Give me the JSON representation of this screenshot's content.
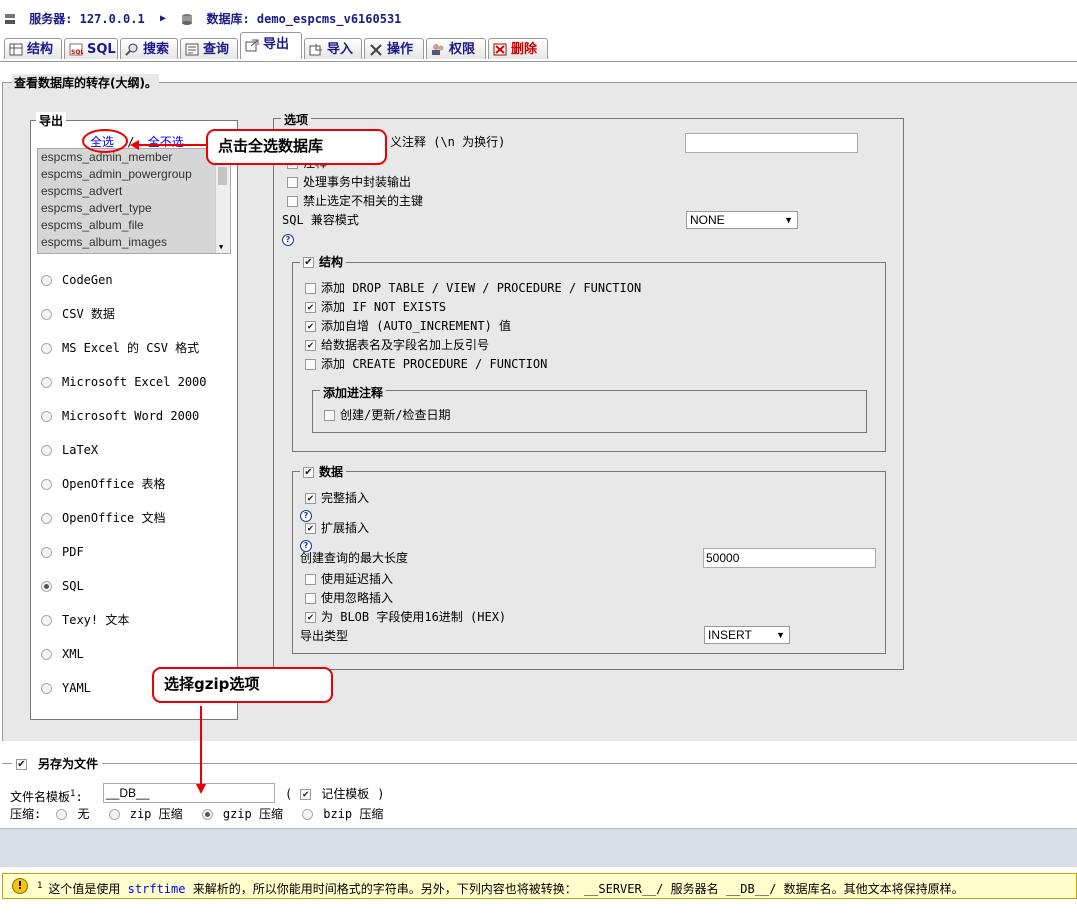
{
  "header": {
    "server_label": "服务器: 127.0.0.1",
    "database_label": "数据库: demo_espcms_v6160531"
  },
  "tabs": [
    {
      "label": "结构",
      "icon": "structure-icon"
    },
    {
      "label": "SQL",
      "icon": "sql-icon"
    },
    {
      "label": "搜索",
      "icon": "search-icon"
    },
    {
      "label": "查询",
      "icon": "query-icon"
    },
    {
      "label": "导出",
      "icon": "export-icon",
      "active": true
    },
    {
      "label": "导入",
      "icon": "import-icon"
    },
    {
      "label": "操作",
      "icon": "operations-icon"
    },
    {
      "label": "权限",
      "icon": "privileges-icon"
    },
    {
      "label": "删除",
      "icon": "drop-icon"
    }
  ],
  "main": {
    "title": "查看数据库的转存(大纲)。"
  },
  "export": {
    "legend": "导出",
    "select_all": "全选",
    "separator": "/",
    "deselect_all": "全不选",
    "databases": [
      "espcms_admin_member",
      "espcms_admin_powergroup",
      "espcms_advert",
      "espcms_advert_type",
      "espcms_album_file",
      "espcms_album_images"
    ],
    "formats": [
      {
        "label": "CodeGen",
        "selected": false
      },
      {
        "label": "CSV 数据",
        "selected": false
      },
      {
        "label": "MS Excel 的 CSV 格式",
        "selected": false
      },
      {
        "label": "Microsoft Excel 2000",
        "selected": false
      },
      {
        "label": "Microsoft Word 2000",
        "selected": false
      },
      {
        "label": "LaTeX",
        "selected": false
      },
      {
        "label": "OpenOffice 表格",
        "selected": false
      },
      {
        "label": "OpenOffice 文档",
        "selected": false
      },
      {
        "label": "PDF",
        "selected": false
      },
      {
        "label": "SQL",
        "selected": true
      },
      {
        "label": "Texy! 文本",
        "selected": false
      },
      {
        "label": "XML",
        "selected": false
      },
      {
        "label": "YAML",
        "selected": false
      }
    ]
  },
  "options": {
    "legend": "选项",
    "custom_comment_label": "义注释 (\\n 为换行)",
    "custom_comment_value": "",
    "partial_label": "注释",
    "transaction_label": "处理事务中封装输出",
    "disable_fk_label": "禁止选定不相关的主键",
    "sql_compat_label": "SQL 兼容模式",
    "sql_compat_value": "NONE",
    "structure": {
      "legend": "结构",
      "drop_table": "添加 DROP TABLE / VIEW / PROCEDURE / FUNCTION",
      "if_not_exists": "添加 IF NOT EXISTS",
      "auto_increment": "添加自增 (AUTO_INCREMENT) 值",
      "backquotes": "给数据表名及字段名加上反引号",
      "create_procedure": "添加 CREATE PROCEDURE / FUNCTION",
      "comments_legend": "添加进注释",
      "dates": "创建/更新/检查日期"
    },
    "data": {
      "legend": "数据",
      "complete_inserts": "完整插入",
      "extended_inserts": "扩展插入",
      "max_query_label": "创建查询的最大长度",
      "max_query_value": "50000",
      "delayed": "使用延迟插入",
      "ignore": "使用忽略插入",
      "hex_blob": "为 BLOB 字段使用16进制 (HEX)",
      "export_type_label": "导出类型",
      "export_type_value": "INSERT"
    }
  },
  "save_as": {
    "legend": "另存为文件",
    "filename_label": "文件名模板",
    "footnote_mark": "1",
    "colon": ":",
    "filename_value": "__DB__",
    "paren_open": "(",
    "remember_label": "记住模板",
    "paren_close": ")",
    "compression_label": "压缩:",
    "compression_options": [
      {
        "label": "无",
        "selected": false
      },
      {
        "label": "zip 压缩",
        "selected": false
      },
      {
        "label": "gzip 压缩",
        "selected": true
      },
      {
        "label": "bzip 压缩",
        "selected": false
      }
    ]
  },
  "notice": {
    "footnote": "1",
    "text_before": "这个值是使用",
    "link": "strftime",
    "text_after": "来解析的，所以你能用时间格式的字符串。另外，下列内容也将被转换： __SERVER__/ 服务器名 __DB__/ 数据库名。其他文本将保持原样。"
  },
  "annotations": {
    "select_all_callout": "点击全选数据库",
    "gzip_callout": "选择gzip选项",
    "color": "#e00000"
  }
}
